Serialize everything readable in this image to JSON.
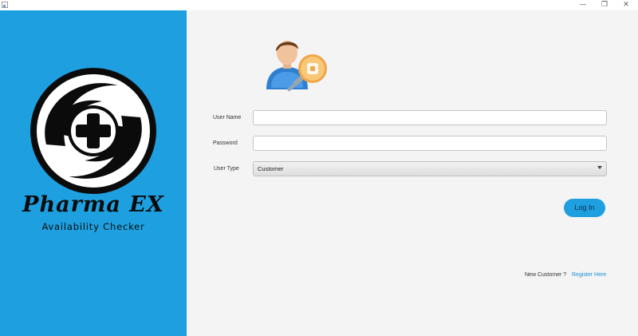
{
  "titlebar": {
    "minimize_glyph": "—",
    "maximize_glyph": "❐",
    "close_glyph": "✕"
  },
  "brand": {
    "title": "Pharma EX",
    "subtitle": "Availability Checker",
    "background_color": "#1e9fe0"
  },
  "form": {
    "username_label": "User Name",
    "username_value": "",
    "password_label": "Password",
    "password_value": "",
    "usertype_label": "User Type",
    "usertype_selected": "Customer",
    "login_label": "Log In"
  },
  "footer": {
    "new_customer_text": "New Customer ?",
    "register_link": "Register Here"
  },
  "icons": {
    "app": "app-icon",
    "user_login": "user-key-icon",
    "logo": "pharmacy-cross-logo"
  },
  "colors": {
    "accent": "#1e9fe0",
    "link": "#1a8fd6"
  }
}
